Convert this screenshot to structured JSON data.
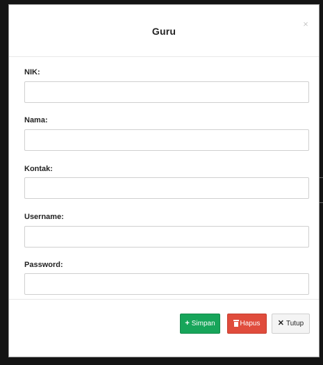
{
  "modal": {
    "title": "Guru",
    "close_glyph": "×"
  },
  "form": {
    "fields": [
      {
        "label": "NIK:",
        "value": "",
        "placeholder": ""
      },
      {
        "label": "Nama:",
        "value": "",
        "placeholder": ""
      },
      {
        "label": "Kontak:",
        "value": "",
        "placeholder": ""
      },
      {
        "label": "Username:",
        "value": "",
        "placeholder": ""
      },
      {
        "label": "Password:",
        "value": "",
        "placeholder": ""
      }
    ]
  },
  "footer": {
    "save_label": "Simpan",
    "save_icon": "plus-icon",
    "delete_label": "Hapus",
    "delete_icon": "trash-icon",
    "close_label": "Tutup",
    "close_icon": "x-icon"
  },
  "colors": {
    "save": "#17a55a",
    "delete": "#e04c3c",
    "close": "#f4f4f4"
  }
}
